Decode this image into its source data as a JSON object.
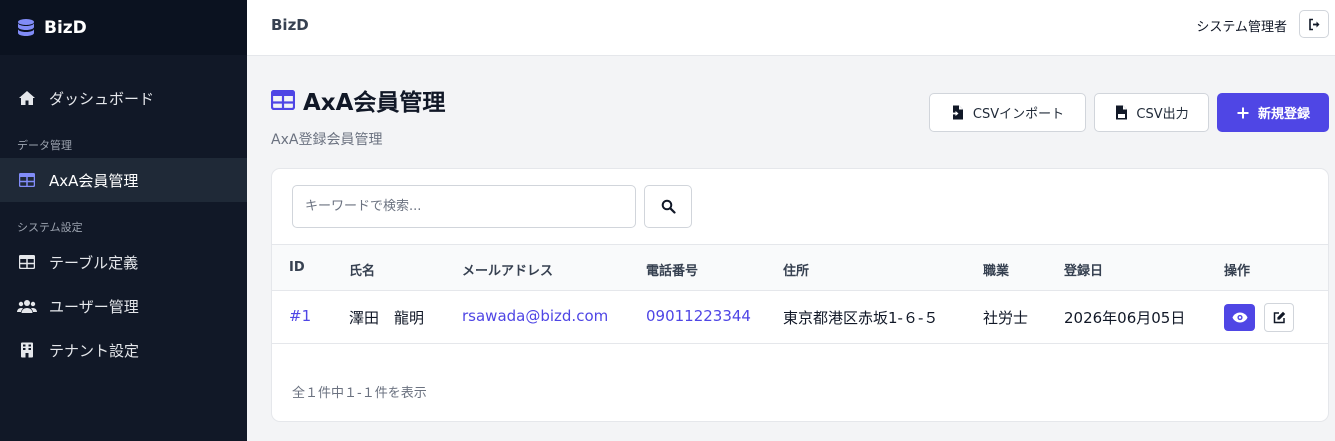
{
  "brand": {
    "name": "BizD"
  },
  "sidebar": {
    "items": [
      {
        "label": "ダッシュボード"
      },
      {
        "label": "AxA会員管理"
      },
      {
        "label": "テーブル定義"
      },
      {
        "label": "ユーザー管理"
      },
      {
        "label": "テナント設定"
      }
    ],
    "sections": [
      "データ管理",
      "システム設定"
    ]
  },
  "topbar": {
    "title": "BizD",
    "user": "システム管理者"
  },
  "page": {
    "title": "AxA会員管理",
    "subtitle": "AxA登録会員管理"
  },
  "actions": {
    "import": "CSVインポート",
    "export": "CSV出力",
    "new": "新規登録"
  },
  "search": {
    "placeholder": "キーワードで検索..."
  },
  "table": {
    "columns": [
      "ID",
      "氏名",
      "メールアドレス",
      "電話番号",
      "住所",
      "職業",
      "登録日",
      "操作"
    ],
    "rows": [
      {
        "id": "#1",
        "name": "澤田　龍明",
        "email": "rsawada@bizd.com",
        "phone": "09011223344",
        "address": "東京都港区赤坂1-６-５",
        "job": "社労士",
        "date": "2026年06月05日"
      }
    ]
  },
  "pagination": {
    "summary": "全１件中１-１件を表示"
  },
  "colors": {
    "primary": "#4f46e5",
    "sidebar_bg": "#111827"
  }
}
